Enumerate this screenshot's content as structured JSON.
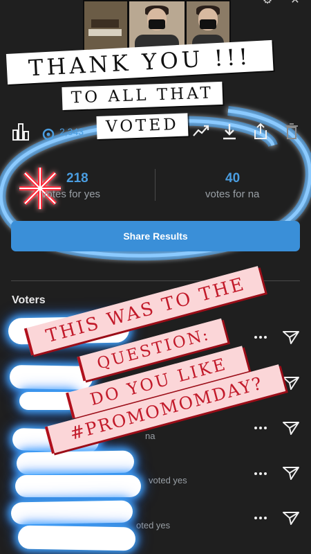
{
  "banners": {
    "thank_you": "THANK YOU !!!",
    "to_all_that": "TO ALL THAT",
    "voted": "VOTED"
  },
  "toolbar": {
    "views_count": "2,343",
    "icons": [
      "bar-chart-icon",
      "eye-icon",
      "trending-icon",
      "download-icon",
      "share-icon",
      "trash-icon"
    ]
  },
  "results": {
    "yes_count": "218",
    "yes_label": "votes for yes",
    "no_count": "40",
    "no_label": "votes for na"
  },
  "share_button": {
    "label": "Share Results"
  },
  "voters": {
    "title": "Voters",
    "rows": [
      {
        "status": "",
        "dots": "•••"
      },
      {
        "status": "",
        "dots": "•••"
      },
      {
        "status": "na",
        "dots": "•••"
      },
      {
        "status": "voted yes",
        "dots": "•••"
      },
      {
        "status": "oted yes",
        "dots": "•••"
      }
    ]
  },
  "question_overlay": {
    "line1": "THIS WAS TO THE",
    "line2": "QUESTION:",
    "line3": "DO YOU LIKE",
    "line4": "#PROMOMOMDAY?"
  },
  "colors": {
    "background": "#1f1f1f",
    "accent_blue": "#3a8fd8",
    "stat_blue": "#4a9de0",
    "overlay_pink": "#fbd6d8",
    "overlay_red": "#c21a2a",
    "glow_blue": "#46aaff",
    "sparkle_red": "#ff2a3a"
  }
}
